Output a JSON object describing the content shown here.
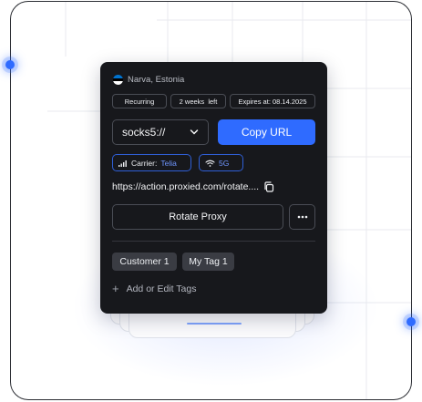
{
  "location": {
    "name": "Narva, Estonia",
    "flag_colors": [
      "#0072ce",
      "#000000",
      "#ffffff"
    ]
  },
  "badges": [
    "Recurring",
    "2 weeks  left",
    "Expires at: 08.14.2025"
  ],
  "protocol": {
    "selected": "socks5://"
  },
  "copy_button": {
    "label": "Copy URL",
    "color": "#2f6bff"
  },
  "network": {
    "carrier_label": "Carrier:",
    "carrier_value": "Telia",
    "signal": "5G",
    "signal_icon": "wifi-icon",
    "carrier_icon": "signal-bars-icon"
  },
  "proxy_url": "https://action.proxied.com/rotate....",
  "rotate_button": {
    "label": "Rotate Proxy"
  },
  "more_button": {
    "icon": "ellipsis-icon"
  },
  "tags": [
    "Customer 1",
    "My Tag 1"
  ],
  "add_tags": {
    "label": "Add or Edit Tags",
    "icon": "plus-icon"
  },
  "colors": {
    "card_bg": "#17181c",
    "accent": "#2f6bff",
    "frame": "#2b2d33"
  }
}
